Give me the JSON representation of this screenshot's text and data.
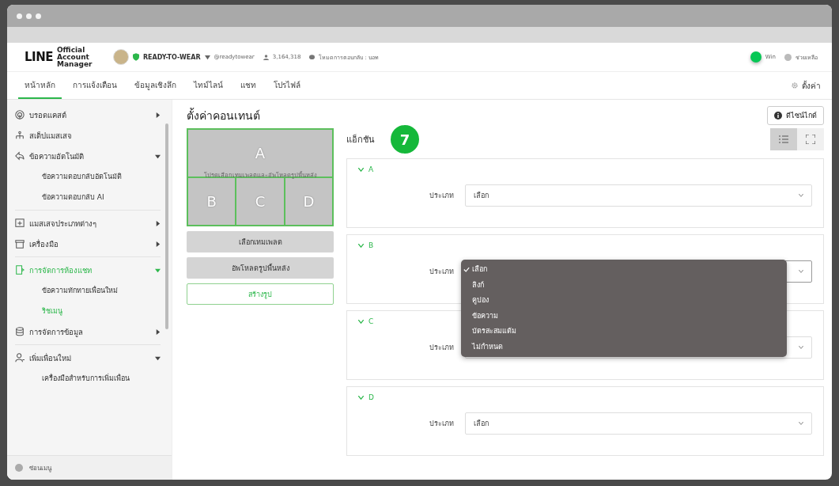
{
  "header": {
    "logo": "LINE",
    "logo_sub": "Official Account Manager",
    "account_name": "READY-TO-WEAR",
    "account_id": "@readytowear",
    "friends": "3,164,318",
    "reply_mode": "โหมดการตอบกลับ : บอท",
    "user": "Win",
    "help": "ช่วยเหลือ"
  },
  "tabs": [
    {
      "label": "หน้าหลัก",
      "selected": true
    },
    {
      "label": "การแจ้งเตือน",
      "selected": false
    },
    {
      "label": "ข้อมูลเชิงลึก",
      "selected": false
    },
    {
      "label": "ไทม์ไลน์",
      "selected": false
    },
    {
      "label": "แชท",
      "selected": false
    },
    {
      "label": "โปรไฟล์",
      "selected": false
    }
  ],
  "settings": "ตั้งค่า",
  "sidebar": {
    "items": [
      {
        "label": "บรอดแคสต์",
        "expanded": false,
        "selected": false
      },
      {
        "label": "สเต็ปแมสเสจ",
        "selected": false
      },
      {
        "label": "ข้อความอัตโนมัติ",
        "expanded": true,
        "selected": false,
        "children": [
          {
            "label": "ข้อความตอบกลับอัตโนมัติ",
            "selected": false
          },
          {
            "label": "ข้อความตอบกลับ AI",
            "selected": false
          }
        ]
      },
      {
        "label": "แมสเสจประเภทต่างๆ",
        "expanded": false,
        "selected": false
      },
      {
        "label": "เครื่องมือ",
        "expanded": false,
        "selected": false
      },
      {
        "label": "การจัดการห้องแชท",
        "expanded": true,
        "selected": true,
        "children": [
          {
            "label": "ข้อความทักทายเพื่อนใหม่",
            "selected": false
          },
          {
            "label": "ริชเมนู",
            "selected": true
          }
        ]
      },
      {
        "label": "การจัดการข้อมูล",
        "expanded": false,
        "selected": false
      },
      {
        "label": "เพิ่มเพื่อนใหม่",
        "expanded": true,
        "selected": false,
        "children": [
          {
            "label": "เครื่องมือสำหรับการเพิ่มเพื่อน",
            "selected": false
          }
        ]
      }
    ],
    "hide_menu": "ซ่อนเมนู"
  },
  "content": {
    "title": "ตั้งค่าคอนเทนต์",
    "design_guide": "ดีไซน์ไกด์",
    "preview": {
      "areas": [
        "A",
        "B",
        "C",
        "D"
      ],
      "hint": "โปรดเลือกเทมเพลตและอัพโหลดรูปพื้นหลัง"
    },
    "buttons": [
      {
        "label": "เลือกเทมเพลต",
        "kind": "secondary"
      },
      {
        "label": "อัพโหลดรูปพื้นหลัง",
        "kind": "secondary"
      },
      {
        "label": "สร้างรูป",
        "kind": "primary"
      }
    ],
    "actions_title": "แอ็กชัน",
    "step_badge": "7",
    "view_toggle": [
      {
        "selected": true
      },
      {
        "selected": false
      }
    ],
    "actions": [
      {
        "name": "A",
        "type_label": "ประเภท",
        "value": "เลือก"
      },
      {
        "name": "B",
        "type_label": "ประเภท",
        "open": true,
        "options": [
          {
            "label": "เลือก",
            "checked": true
          },
          {
            "label": "ลิงก์",
            "checked": false
          },
          {
            "label": "คูปอง",
            "checked": false
          },
          {
            "label": "ข้อความ",
            "checked": false
          },
          {
            "label": "บัตรสะสมแต้ม",
            "checked": false
          },
          {
            "label": "ไม่กำหนด",
            "checked": false
          }
        ]
      },
      {
        "name": "C",
        "type_label": "ประเภท"
      },
      {
        "name": "D",
        "type_label": "ประเภท",
        "value": "เลือก"
      }
    ]
  }
}
